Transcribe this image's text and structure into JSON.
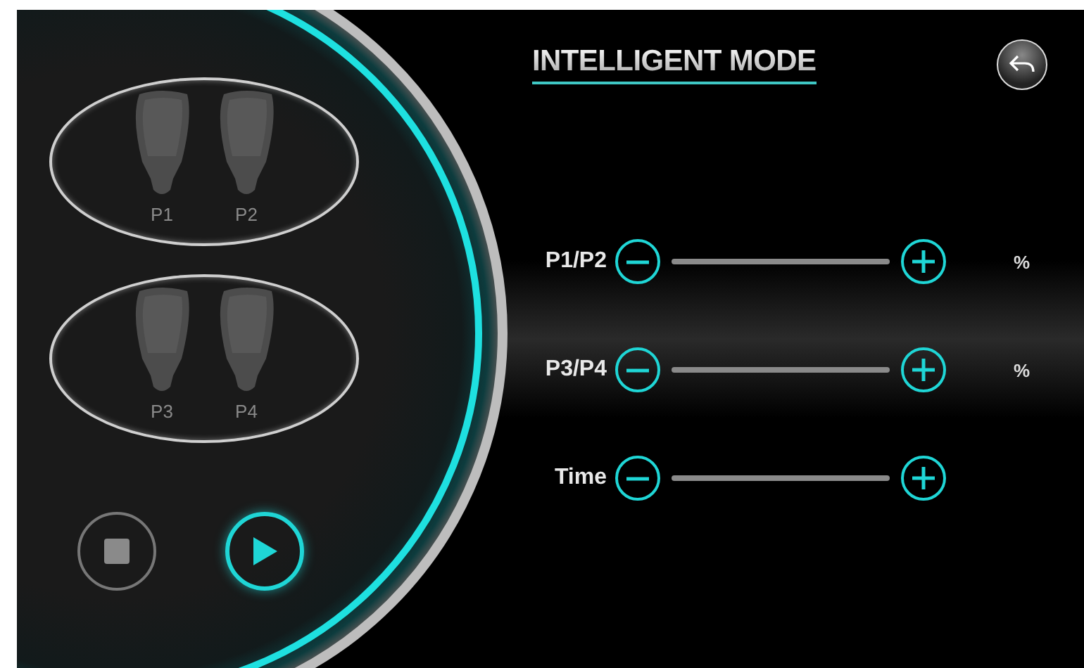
{
  "header": {
    "title": "INTELLIGENT MODE"
  },
  "probe_groups": [
    {
      "probes": [
        "P1",
        "P2"
      ]
    },
    {
      "probes": [
        "P3",
        "P4"
      ]
    }
  ],
  "transport": [
    {
      "kind": "stop",
      "active": false
    },
    {
      "kind": "play",
      "active": true
    }
  ],
  "settings": [
    {
      "label": "P1/P2",
      "unit": "%"
    },
    {
      "label": "P3/P4",
      "unit": "%"
    },
    {
      "label": "Time"
    }
  ]
}
